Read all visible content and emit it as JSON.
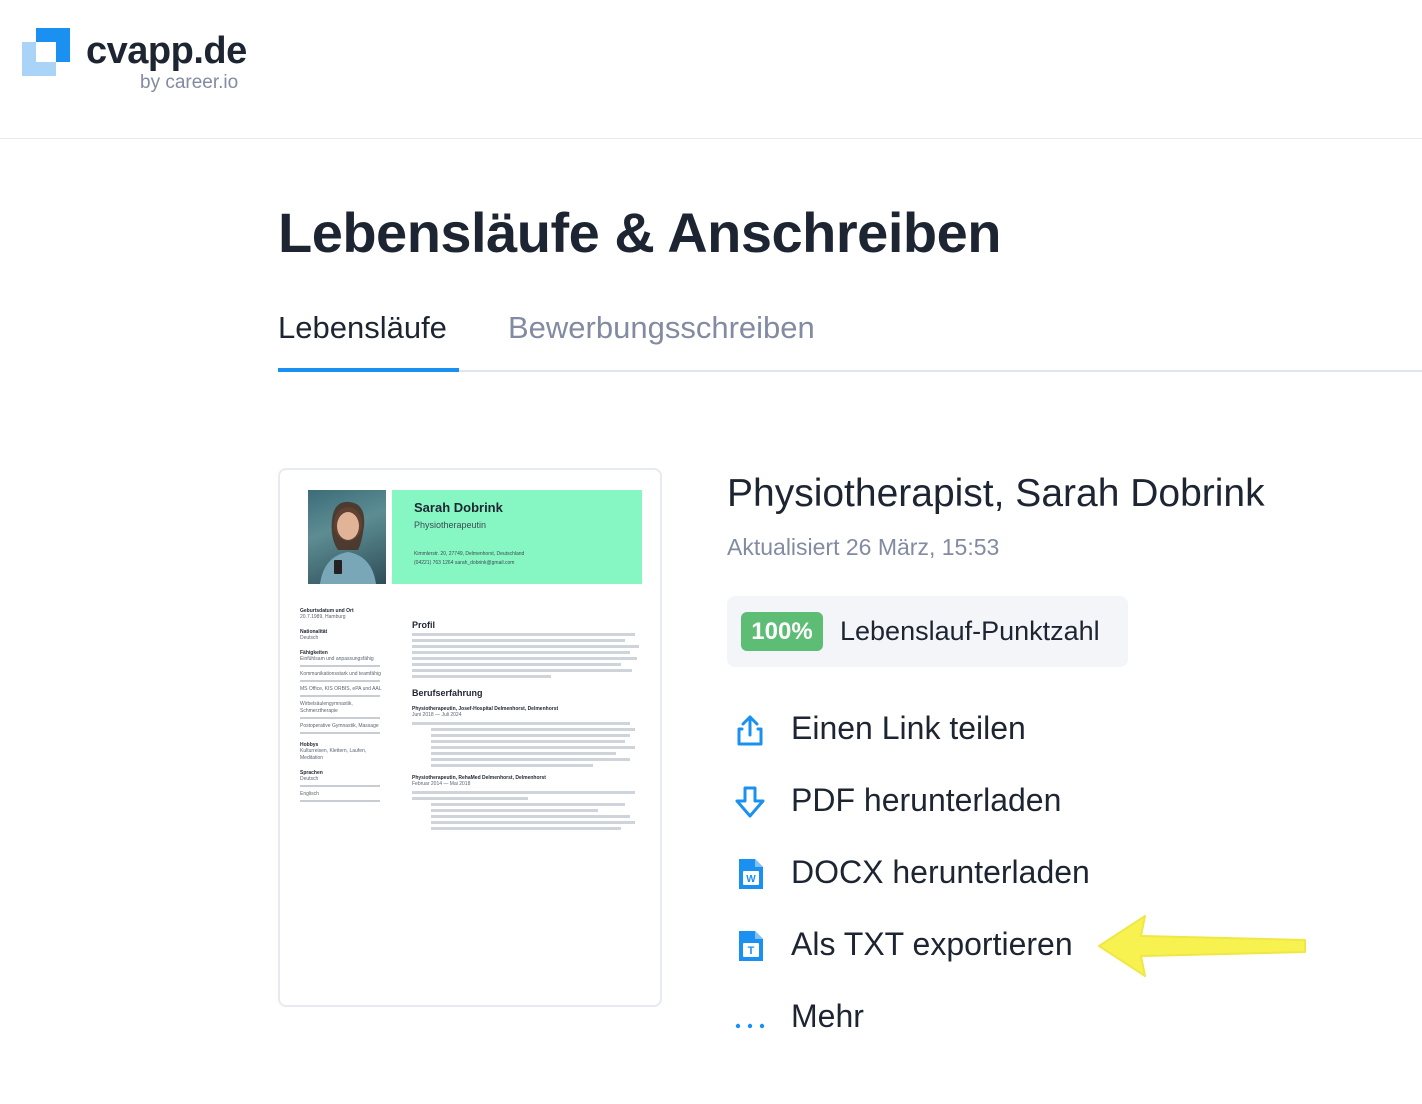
{
  "brand": {
    "name": "cvapp.de",
    "sub": "by career.io",
    "accent": "#1a91f0",
    "light_accent": "#a9d4f7"
  },
  "page": {
    "title": "Lebensläufe & Anschreiben"
  },
  "tabs": [
    {
      "label": "Lebensläufe",
      "active": true
    },
    {
      "label": "Bewerbungsschreiben",
      "active": false
    }
  ],
  "resume": {
    "title": "Physiotherapist, Sarah Dobrink",
    "updated": "Aktualisiert 26 März, 15:53",
    "score": {
      "value": "100%",
      "label": "Lebenslauf-Punktzahl",
      "color": "#5dbd75"
    },
    "preview": {
      "header_color": "#86f7c2",
      "name": "Sarah Dobrink",
      "role": "Physiotherapeutin",
      "address": "Kimmlerstr. 20, 27749, Delmenhorst, Deutschland",
      "phone_email": "(04221) 763 1264    sarah_dobrink@gmail.com",
      "sidebar": [
        {
          "heading": "Geburtsdatum und Ort",
          "text": "20.7.1989, Hamburg"
        },
        {
          "heading": "Nationalität",
          "text": "Deutsch"
        },
        {
          "heading": "Fähigkeiten",
          "text": "Einfühlsam und anpassungsfähig"
        },
        {
          "heading": "",
          "text": "Kommunikationsstark und teamfähig"
        },
        {
          "heading": "",
          "text": "MS Office, KIS ORBIS, ePA und AAL"
        },
        {
          "heading": "",
          "text": "Wirbelsäulengymnastik, Schmerztherapie"
        },
        {
          "heading": "",
          "text": "Postoperative Gymnastik, Massage"
        },
        {
          "heading": "Hobbys",
          "text": "Kulturreisen, Klettern, Laufen, Meditation"
        },
        {
          "heading": "Sprachen",
          "text": "Deutsch"
        },
        {
          "heading": "",
          "text": "Englisch"
        }
      ],
      "sections": {
        "profile": "Profil",
        "experience": "Berufserfahrung",
        "job1": "Physiotherapeutin, Josef-Hospital Delmenhorst, Delmenhorst",
        "job1_dates": "Juni 2018 — Juli 2024",
        "job2": "Physiotherapeutin, RehaMed Delmenhorst, Delmenhorst",
        "job2_dates": "Februar 2014 — Mai 2018"
      }
    }
  },
  "actions": [
    {
      "label": "Einen Link teilen",
      "icon": "share-icon"
    },
    {
      "label": "PDF herunterladen",
      "icon": "download-icon"
    },
    {
      "label": "DOCX herunterladen",
      "icon": "docx-file-icon"
    },
    {
      "label": "Als TXT exportieren",
      "icon": "txt-file-icon"
    },
    {
      "label": "Mehr",
      "icon": "more-dots-icon"
    }
  ],
  "annotation": {
    "color": "#f7f246",
    "icon": "arrow-left-annotation"
  }
}
